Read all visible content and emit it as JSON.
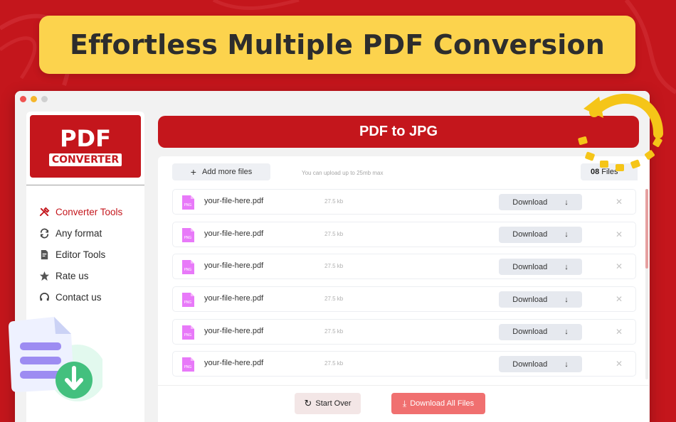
{
  "banner": {
    "title": "Effortless Multiple PDF Conversion"
  },
  "logo": {
    "main": "PDF",
    "sub": "CONVERTER"
  },
  "sidebar": {
    "items": [
      {
        "label": "Converter Tools",
        "icon": "tools-icon",
        "active": true
      },
      {
        "label": "Any format",
        "icon": "sync-icon",
        "active": false
      },
      {
        "label": "Editor Tools",
        "icon": "edit-doc-icon",
        "active": false
      },
      {
        "label": "Rate us",
        "icon": "star-icon",
        "active": false
      },
      {
        "label": "Contact us",
        "icon": "headset-icon",
        "active": false
      }
    ]
  },
  "main": {
    "title": "PDF to JPG",
    "add_files_label": "Add more files",
    "upload_hint": "You can upload up to 25mb max",
    "files_count": "08",
    "files_label": "Files",
    "download_label": "Download",
    "files": [
      {
        "name": "your-file-here.pdf",
        "size": "27.5 kb",
        "type": "PNG"
      },
      {
        "name": "your-file-here.pdf",
        "size": "27.5 kb",
        "type": "PNG"
      },
      {
        "name": "your-file-here.pdf",
        "size": "27.5 kb",
        "type": "PNG"
      },
      {
        "name": "your-file-here.pdf",
        "size": "27.5 kb",
        "type": "PNG"
      },
      {
        "name": "your-file-here.pdf",
        "size": "27.5 kb",
        "type": "PNG"
      },
      {
        "name": "your-file-here.pdf",
        "size": "27.5 kb",
        "type": "PNG"
      }
    ],
    "start_over_label": "Start Over",
    "download_all_label": "Download All Files"
  },
  "colors": {
    "brand": "#c4161c",
    "banner": "#fcd34d",
    "accent_light": "#f07070"
  }
}
